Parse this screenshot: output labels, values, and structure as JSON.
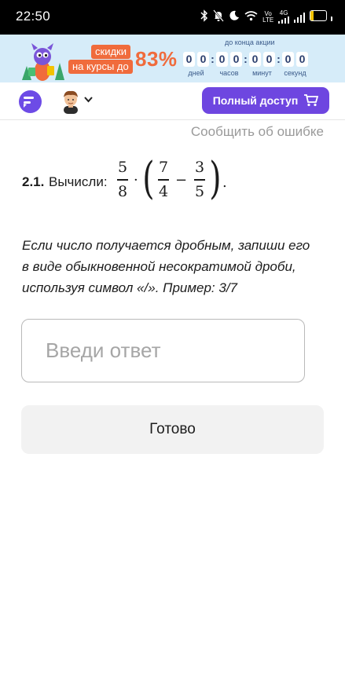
{
  "status_bar": {
    "time": "22:50",
    "volte": "Vo LTE",
    "network": "4G",
    "battery": "21",
    "battery_level": 0.21,
    "icons": [
      "bluetooth-icon",
      "bell-off-icon",
      "moon-icon",
      "wifi-icon",
      "signal-icon",
      "battery-icon"
    ]
  },
  "promo": {
    "tag_line1": "скидки",
    "tag_line2": "на курсы до",
    "discount": "83%",
    "until_label": "до конца акции",
    "timer": [
      {
        "digits": [
          "0",
          "0"
        ],
        "label": "дней"
      },
      {
        "digits": [
          "0",
          "0"
        ],
        "label": "часов"
      },
      {
        "digits": [
          "0",
          "0"
        ],
        "label": "минут"
      },
      {
        "digits": [
          "0",
          "0"
        ],
        "label": "секунд"
      }
    ],
    "accent_color": "#f06b3c",
    "background_color": "#d6ecf9"
  },
  "header": {
    "full_access_label": "Полный доступ",
    "brand_color": "#6e46e0"
  },
  "report_link": "Сообщить об ошибке",
  "task": {
    "number": "2.1.",
    "verb": "Вычисли:",
    "expression": {
      "f1_num": "5",
      "f1_den": "8",
      "dot": "·",
      "lparen": "(",
      "f2_num": "7",
      "f2_den": "4",
      "minus": "−",
      "f3_num": "3",
      "f3_den": "5",
      "rparen": ")",
      "end": "."
    }
  },
  "hint": "Если число получается дробным, запиши его в виде обыкновенной несократимой дроби, используя символ «/». Пример: 3/7",
  "answer": {
    "placeholder": "Введи ответ",
    "value": ""
  },
  "done_label": "Готово"
}
